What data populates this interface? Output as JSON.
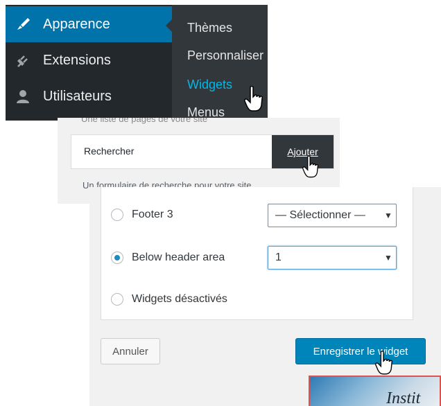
{
  "menu": {
    "items": [
      {
        "label": "Apparence",
        "icon": "paintbrush-icon",
        "active": true
      },
      {
        "label": "Extensions",
        "icon": "plugin-icon",
        "active": false
      },
      {
        "label": "Utilisateurs",
        "icon": "user-icon",
        "active": false
      }
    ],
    "submenu": [
      "Thèmes",
      "Personnaliser",
      "Widgets",
      "Menus"
    ],
    "current_submenu": "Widgets",
    "colors": {
      "background": "#23282d",
      "active": "#0073aa",
      "submenu_bg": "#32373c",
      "current_link": "#00b9eb"
    }
  },
  "widget": {
    "title": "Rechercher",
    "add_label": "Ajouter",
    "description": "Un formulaire de recherche pour votre site",
    "cut_text": "Une liste de pages de votre site"
  },
  "chooser": {
    "options": [
      {
        "label": "Footer 3",
        "checked": false,
        "select_value": "— Sélectionner —",
        "has_select": true
      },
      {
        "label": "Below header area",
        "checked": true,
        "select_value": "1",
        "has_select": true
      },
      {
        "label": "Widgets désactivés",
        "checked": false,
        "has_select": false
      }
    ],
    "cancel_label": "Annuler",
    "save_label": "Enregistrer le widget",
    "save_color": "#0085ba"
  },
  "thumbnail": {
    "text": "Instit"
  }
}
